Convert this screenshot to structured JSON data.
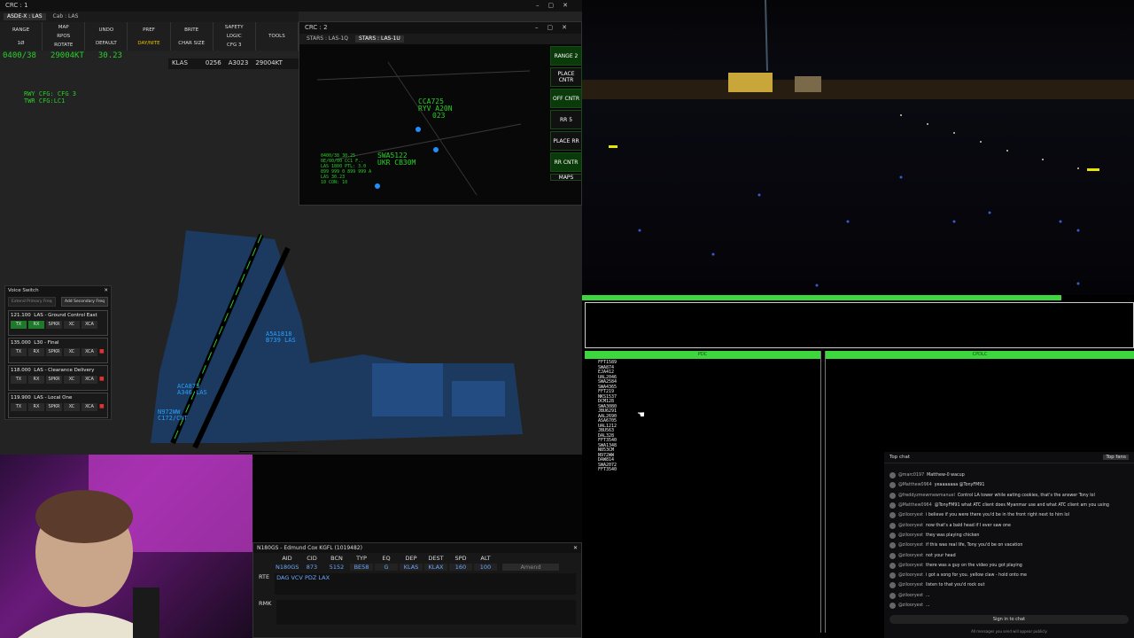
{
  "crc1": {
    "title": "CRC : 1",
    "tabs": [
      "ASDE-X : LAS",
      "Cab : LAS"
    ],
    "dcb": [
      {
        "l1": "RANGE",
        "l2": "1Ø"
      },
      {
        "l1": "MAP",
        "l2": "RPOS",
        "l3": "ROTATE"
      },
      {
        "l1": "UNDO",
        "l2": "DEFAULT"
      },
      {
        "l1": "PREF",
        "l2": "DAY/NITE"
      },
      {
        "l1": "BRITE",
        "l2": "CHAR SIZE"
      },
      {
        "l1": "SAFETY",
        "l2": "LOGIC",
        "l3": "CFG 3"
      },
      {
        "l1": "TOOLS"
      }
    ],
    "time_line": "0400/38",
    "wind": "29004KT",
    "altimeter": "30.23",
    "airport": "KLAS",
    "flightinfo1": "0256",
    "flightinfo2": "A3023",
    "flightinfo3": "29004KT",
    "rwy_cfg": "RWY CFG: CFG 3",
    "twr_cfg": "TWR CFG:LC1",
    "targets": [
      {
        "cs": "A5A1818",
        "typ": "B739 LAS"
      },
      {
        "cs": "ACA873",
        "typ": "A346 LAS"
      },
      {
        "cs": "N972WW",
        "typ": "C172/CNT"
      }
    ]
  },
  "crc2": {
    "title": "CRC : 2",
    "tabs": [
      "STARS : LAS-1Q",
      "STARS : LAS-1U"
    ],
    "tags": [
      {
        "cs": "CCA725",
        "l2": "RYV  A20N",
        "l3": "023"
      },
      {
        "cs": "SWA5122",
        "l2": "UKR CB30M"
      }
    ],
    "ssa": [
      "0400/38 30.25",
      "0E/00/00 CC1 F..",
      "LAS 1800 PTL: 3.0",
      "899 999 0 899 999 A",
      "LAS 30.23",
      "10 CON: 10"
    ],
    "buttons": [
      {
        "label": "RANGE 2",
        "green": true
      },
      {
        "label": "PLACE CNTR",
        "green": false
      },
      {
        "label": "OFF CNTR",
        "green": true
      },
      {
        "label": "RR 5",
        "green": false
      },
      {
        "label": "PLACE RR",
        "green": false
      },
      {
        "label": "RR CNTR",
        "green": true
      },
      {
        "label": "MAPS",
        "green": false
      }
    ]
  },
  "voice": {
    "title": "Voice Switch",
    "extend_label": "Extend Primary Freq",
    "add_label": "Add Secondary Freq",
    "rows": [
      {
        "freq": "121.100",
        "name": "LAS - Ground Control East",
        "tx": true,
        "rx": true
      },
      {
        "freq": "135.000",
        "name": "L30 - Final",
        "tx": false,
        "rx": false
      },
      {
        "freq": "118.000",
        "name": "LAS - Clearance Delivery",
        "tx": false,
        "rx": false
      },
      {
        "freq": "119.900",
        "name": "LAS - Local One",
        "tx": false,
        "rx": false
      }
    ],
    "btn_labels": [
      "TX",
      "RX",
      "SPKR",
      "XC",
      "XCA"
    ]
  },
  "flightplan": {
    "title": "N180GS - Edmund Cox KGFL (1019482)",
    "headers": [
      "AID",
      "CID",
      "BCN",
      "TYP",
      "EQ",
      "DEP",
      "DEST",
      "SPD",
      "ALT"
    ],
    "values": [
      "N180GS",
      "873",
      "5152",
      "BE58",
      "G",
      "KLAS",
      "KLAX",
      "160",
      "100"
    ],
    "amend": "Amend",
    "rte_label": "RTE",
    "route": "DAG VCV PDZ LAX",
    "rmk_label": "RMK"
  },
  "cpdlc": {
    "left_header": "PDC",
    "right_header": "CPDLC",
    "callsigns": [
      "FFT1589",
      "SWA874",
      "EJA412",
      "UAL2046",
      "SWA2584",
      "SWA4365",
      "FFT219",
      "NKS1537",
      "DCM128",
      "SWA3080",
      "JBU6291",
      "AAL2690",
      "ASA6705",
      "UAL1212",
      "JBU563",
      "DAL328",
      "FFT3540",
      "SWA1348",
      "N853CM",
      "N972WW",
      "DAW814",
      "SWA2072",
      "FFT3540"
    ]
  },
  "chat": {
    "header": "Top chat",
    "top_fans": "Top fans",
    "lines": [
      {
        "name": "@marc0197",
        "msg": "Matthew-0 wacup"
      },
      {
        "name": "@Matthew0964",
        "msg": "yeaaaaaaa @TonyFM91"
      },
      {
        "name": "@freddyzmewmewmanuel",
        "msg": "Control LA tower while eating cookies, that's the answer Tony lol"
      },
      {
        "name": "@Matthew0964",
        "msg": "@TonyFM91 what ATC client does Myanmar use and what ATC client am you using"
      },
      {
        "name": "@zilooryest",
        "msg": "i believe if you were there you'd be in the front right next to him lol"
      },
      {
        "name": "@zilooryest",
        "msg": "now that's a bald head if I ever saw one"
      },
      {
        "name": "@zilooryest",
        "msg": "they was playing chicken"
      },
      {
        "name": "@zilooryest",
        "msg": "if this was real life, Tony you'd be on vacation"
      },
      {
        "name": "@zilooryest",
        "msg": "not your head"
      },
      {
        "name": "@zilooryest",
        "msg": "there was a guy on the video you got playing"
      },
      {
        "name": "@zilooryest",
        "msg": "i got a song for you. yellow claw - hold onto me"
      },
      {
        "name": "@zilooryest",
        "msg": "listen to that you'd rock out"
      },
      {
        "name": "@zilooryest",
        "msg": "..."
      },
      {
        "name": "@zilooryest",
        "msg": "..."
      }
    ],
    "signin": "Sign in to chat",
    "footer": "All messages you send will appear publicly"
  }
}
